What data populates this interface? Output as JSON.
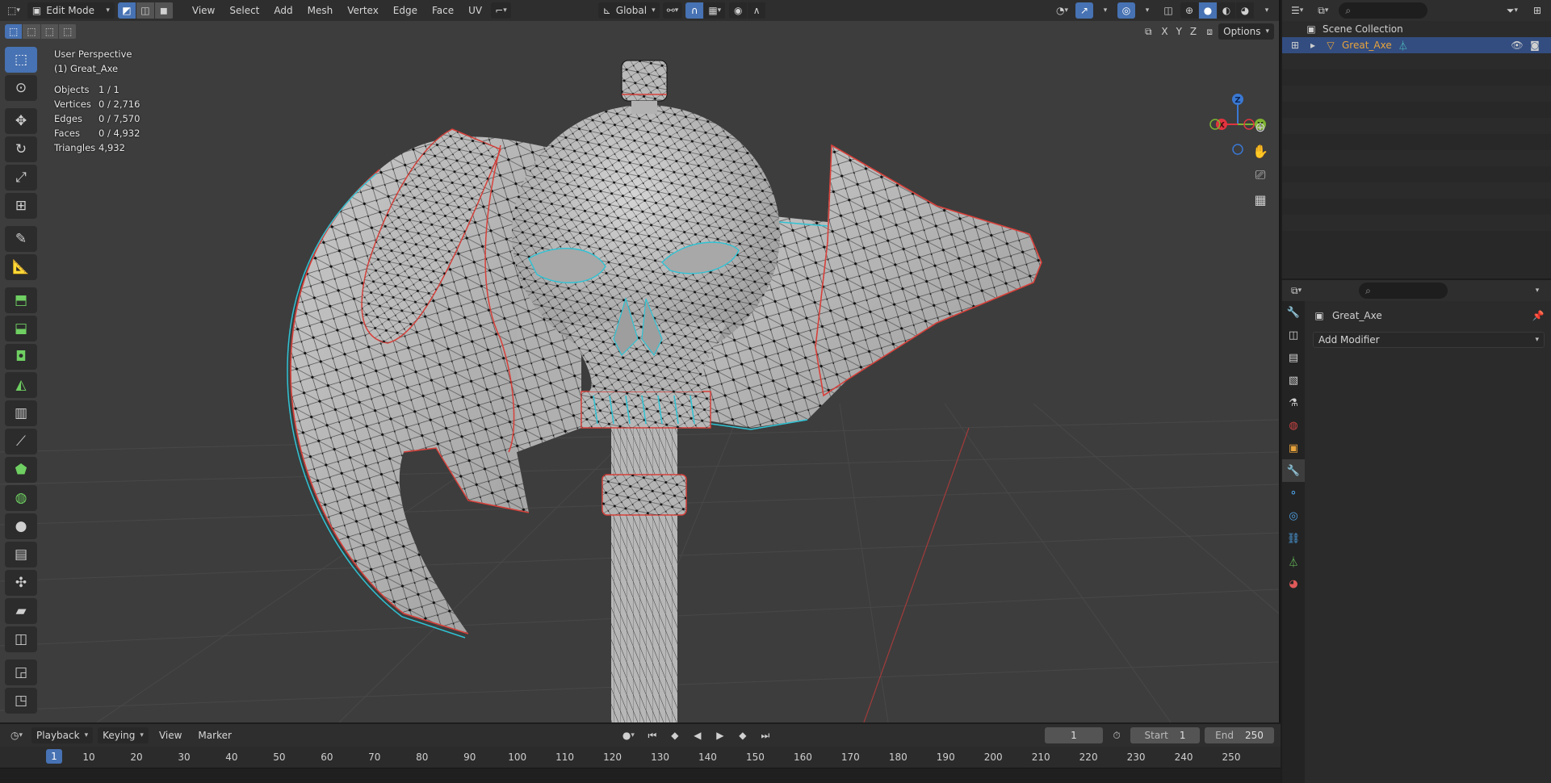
{
  "viewport": {
    "mode": "Edit Mode",
    "menus": [
      "View",
      "Select",
      "Add",
      "Mesh",
      "Vertex",
      "Edge",
      "Face",
      "UV"
    ],
    "orientation": "Global",
    "options_label": "Options",
    "axes": [
      "X",
      "Y",
      "Z"
    ],
    "info": {
      "perspective": "User Perspective",
      "object": "(1) Great_Axe",
      "stats": [
        {
          "label": "Objects",
          "value": "1 / 1"
        },
        {
          "label": "Vertices",
          "value": "0 / 2,716"
        },
        {
          "label": "Edges",
          "value": "0 / 7,570"
        },
        {
          "label": "Faces",
          "value": "0 / 4,932"
        },
        {
          "label": "Triangles",
          "value": "4,932"
        }
      ]
    },
    "gizmo": {
      "x": "X",
      "y": "Y",
      "z": "Z",
      "colors": {
        "x": "#e0343f",
        "y": "#7fb431",
        "z": "#3a78d4"
      }
    }
  },
  "timeline": {
    "menus": [
      "Playback",
      "Keying",
      "View",
      "Marker"
    ],
    "current_frame": "1",
    "start_label": "Start",
    "start_value": "1",
    "end_label": "End",
    "end_value": "250",
    "marker_frame": "1",
    "ticks": [
      "10",
      "20",
      "30",
      "40",
      "50",
      "60",
      "70",
      "80",
      "90",
      "100",
      "110",
      "120",
      "130",
      "140",
      "150",
      "160",
      "170",
      "180",
      "190",
      "200",
      "210",
      "220",
      "230",
      "240",
      "250"
    ]
  },
  "outliner": {
    "collection": "Scene Collection",
    "object": "Great_Axe"
  },
  "properties": {
    "object_name": "Great_Axe",
    "add_modifier": "Add Modifier"
  },
  "colors": {
    "accent": "#4772b3",
    "selected_row": "#334d80",
    "seam": "#d8403a",
    "sharp": "#2fc3d4",
    "object_orange": "#e8a33c"
  }
}
